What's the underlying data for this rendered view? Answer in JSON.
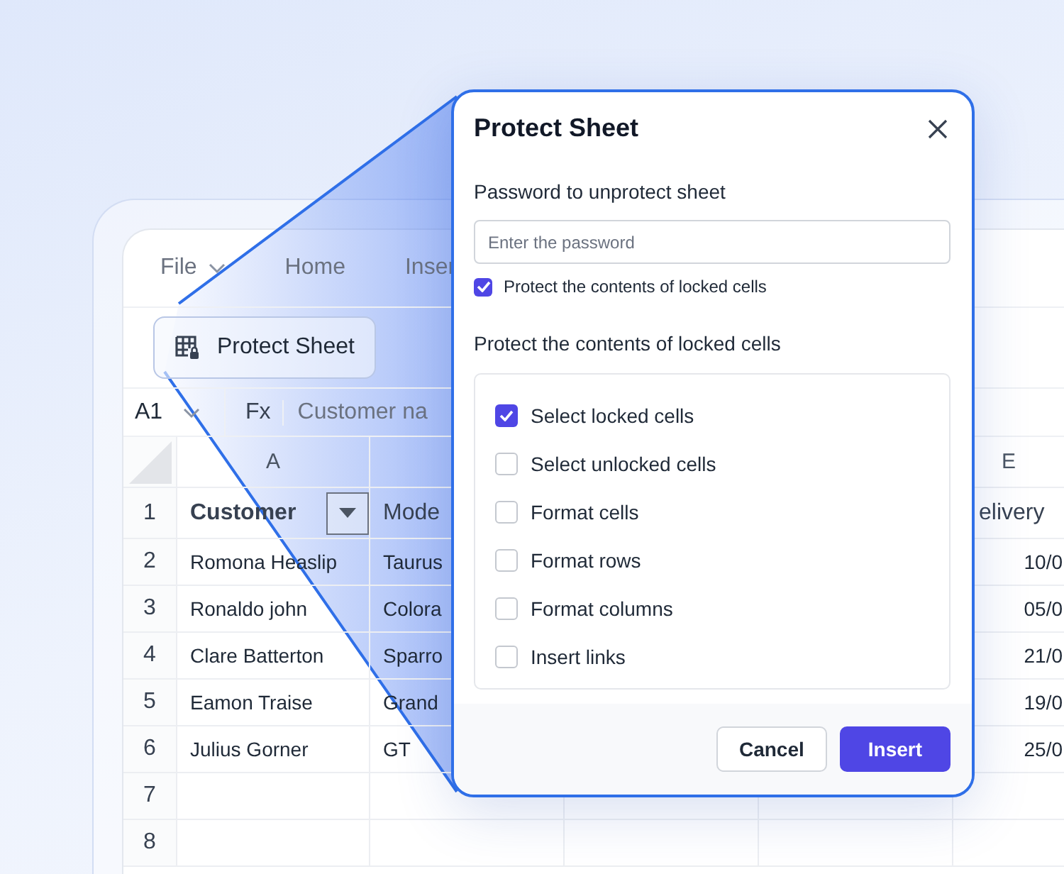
{
  "menu": [
    {
      "label": "File",
      "dropdown": true
    },
    {
      "label": "Home",
      "dropdown": false
    },
    {
      "label": "Inser",
      "dropdown": false
    }
  ],
  "toolbar": {
    "button": "Protect Sheet"
  },
  "formula_bar": {
    "cell_ref": "A1",
    "fx": "Fx",
    "content": "Customer na"
  },
  "columns": [
    {
      "label": "A"
    },
    {},
    {},
    {},
    {
      "label": "E"
    }
  ],
  "rows": [
    {
      "number": "1",
      "kind": "header",
      "filter": true,
      "cells": [
        "Customer",
        "Mode",
        null,
        null,
        "elivery"
      ]
    },
    {
      "number": "2",
      "kind": "data",
      "cells": [
        "Romona Heaslip",
        "Taurus",
        null,
        null,
        "10/0"
      ]
    },
    {
      "number": "3",
      "kind": "data",
      "cells": [
        "Ronaldo john",
        "Colora",
        null,
        null,
        "05/0"
      ]
    },
    {
      "number": "4",
      "kind": "data",
      "cells": [
        "Clare Batterton",
        "Sparro",
        null,
        null,
        "21/0"
      ]
    },
    {
      "number": "5",
      "kind": "data",
      "cells": [
        "Eamon Traise",
        "Grand",
        null,
        null,
        "19/0"
      ]
    },
    {
      "number": "6",
      "kind": "data",
      "cells": [
        "Julius Gorner",
        "GT",
        null,
        null,
        "25/0"
      ]
    },
    {
      "number": "7",
      "kind": "data",
      "cells": [
        null,
        null,
        null,
        null,
        null
      ]
    },
    {
      "number": "8",
      "kind": "data",
      "cells": [
        null,
        null,
        null,
        null,
        null
      ]
    }
  ],
  "dialog": {
    "title": "Protect Sheet",
    "password_label": "Password to unprotect sheet",
    "password": {
      "placeholder": "Enter the password"
    },
    "protect_toggle": {
      "label": "Protect the contents of locked cells",
      "checked": true
    },
    "section_title": "Protect the contents of locked cells",
    "options": [
      {
        "label": "Select locked cells",
        "checked": true
      },
      {
        "label": "Select unlocked cells",
        "checked": false
      },
      {
        "label": "Format cells",
        "checked": false
      },
      {
        "label": "Format rows",
        "checked": false
      },
      {
        "label": "Format columns",
        "checked": false
      },
      {
        "label": "Insert links",
        "checked": false
      }
    ],
    "buttons": [
      {
        "label": "Cancel",
        "kind": "secondary"
      },
      {
        "label": "Insert",
        "kind": "primary"
      }
    ]
  }
}
